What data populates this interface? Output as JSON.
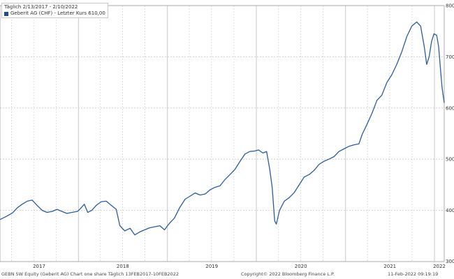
{
  "legend": {
    "date_range": "Täglich 2/13/2017 - 2/10/2022",
    "series_label": "Geberit AG (CHF) - Letzter Kurs 610,00"
  },
  "footer": {
    "left": "GEBN SW Equity (Geberit AG) Chart one share   Täglich 13FEB2017-10FEB2022",
    "center": "Copyright© 2022 Bloomberg Finance L.P.",
    "right": "11-Feb-2022 09:19:19"
  },
  "colors": {
    "line": "#2a5d9e",
    "grid": "#c8c8c8",
    "axis_text": "#333333"
  },
  "chart_data": {
    "type": "line",
    "title": "",
    "xlabel": "",
    "ylabel": "",
    "ylim": [
      300,
      800
    ],
    "yticks": [
      300,
      400,
      500,
      600,
      700,
      800
    ],
    "xlim": [
      "2017-02-13",
      "2022-02-10"
    ],
    "xtick_labels": [
      "2017",
      "2018",
      "2019",
      "2020",
      "2021",
      "2022"
    ],
    "grid": true,
    "legend_position": "top-left",
    "series": [
      {
        "name": "Geberit AG (CHF) - Letzter Kurs 610,00",
        "points": [
          [
            "2017-02-13",
            382
          ],
          [
            "2017-03-10",
            388
          ],
          [
            "2017-04-05",
            395
          ],
          [
            "2017-04-25",
            405
          ],
          [
            "2017-05-15",
            412
          ],
          [
            "2017-06-05",
            418
          ],
          [
            "2017-06-25",
            420
          ],
          [
            "2017-07-15",
            410
          ],
          [
            "2017-08-05",
            400
          ],
          [
            "2017-08-25",
            396
          ],
          [
            "2017-09-15",
            398
          ],
          [
            "2017-10-05",
            402
          ],
          [
            "2017-10-25",
            398
          ],
          [
            "2017-11-15",
            394
          ],
          [
            "2017-12-05",
            396
          ],
          [
            "2017-12-28",
            398
          ],
          [
            "2018-01-10",
            404
          ],
          [
            "2018-01-25",
            412
          ],
          [
            "2018-02-08",
            396
          ],
          [
            "2018-02-25",
            400
          ],
          [
            "2018-03-15",
            410
          ],
          [
            "2018-04-05",
            417
          ],
          [
            "2018-04-25",
            418
          ],
          [
            "2018-05-15",
            410
          ],
          [
            "2018-06-05",
            402
          ],
          [
            "2018-06-20",
            370
          ],
          [
            "2018-07-10",
            360
          ],
          [
            "2018-08-01",
            365
          ],
          [
            "2018-08-20",
            352
          ],
          [
            "2018-09-10",
            358
          ],
          [
            "2018-09-30",
            362
          ],
          [
            "2018-10-20",
            366
          ],
          [
            "2018-11-10",
            368
          ],
          [
            "2018-12-01",
            370
          ],
          [
            "2018-12-20",
            362
          ],
          [
            "2019-01-10",
            375
          ],
          [
            "2019-01-30",
            385
          ],
          [
            "2019-02-20",
            405
          ],
          [
            "2019-03-15",
            422
          ],
          [
            "2019-04-05",
            428
          ],
          [
            "2019-04-25",
            434
          ],
          [
            "2019-05-15",
            430
          ],
          [
            "2019-06-05",
            432
          ],
          [
            "2019-06-25",
            440
          ],
          [
            "2019-07-15",
            445
          ],
          [
            "2019-08-05",
            448
          ],
          [
            "2019-08-25",
            460
          ],
          [
            "2019-09-15",
            470
          ],
          [
            "2019-10-05",
            480
          ],
          [
            "2019-10-25",
            495
          ],
          [
            "2019-11-15",
            510
          ],
          [
            "2019-12-05",
            515
          ],
          [
            "2019-12-25",
            516
          ],
          [
            "2020-01-10",
            518
          ],
          [
            "2020-01-28",
            512
          ],
          [
            "2020-02-12",
            515
          ],
          [
            "2020-02-25",
            480
          ],
          [
            "2020-03-06",
            445
          ],
          [
            "2020-03-16",
            380
          ],
          [
            "2020-03-23",
            373
          ],
          [
            "2020-04-05",
            400
          ],
          [
            "2020-04-25",
            418
          ],
          [
            "2020-05-15",
            425
          ],
          [
            "2020-06-05",
            435
          ],
          [
            "2020-06-25",
            450
          ],
          [
            "2020-07-15",
            465
          ],
          [
            "2020-08-05",
            470
          ],
          [
            "2020-08-25",
            478
          ],
          [
            "2020-09-15",
            490
          ],
          [
            "2020-10-05",
            496
          ],
          [
            "2020-10-25",
            500
          ],
          [
            "2020-11-15",
            505
          ],
          [
            "2020-12-05",
            515
          ],
          [
            "2020-12-25",
            520
          ],
          [
            "2021-01-15",
            525
          ],
          [
            "2021-02-05",
            528
          ],
          [
            "2021-02-25",
            530
          ],
          [
            "2021-03-10",
            548
          ],
          [
            "2021-03-30",
            568
          ],
          [
            "2021-04-20",
            590
          ],
          [
            "2021-05-10",
            615
          ],
          [
            "2021-05-30",
            625
          ],
          [
            "2021-06-20",
            650
          ],
          [
            "2021-07-10",
            665
          ],
          [
            "2021-07-30",
            685
          ],
          [
            "2021-08-20",
            710
          ],
          [
            "2021-09-10",
            740
          ],
          [
            "2021-09-30",
            760
          ],
          [
            "2021-10-20",
            768
          ],
          [
            "2021-11-05",
            760
          ],
          [
            "2021-11-20",
            720
          ],
          [
            "2021-11-30",
            685
          ],
          [
            "2021-12-10",
            700
          ],
          [
            "2021-12-20",
            730
          ],
          [
            "2021-12-30",
            745
          ],
          [
            "2022-01-10",
            742
          ],
          [
            "2022-01-18",
            720
          ],
          [
            "2022-01-25",
            680
          ],
          [
            "2022-02-01",
            640
          ],
          [
            "2022-02-10",
            610
          ]
        ]
      }
    ]
  }
}
